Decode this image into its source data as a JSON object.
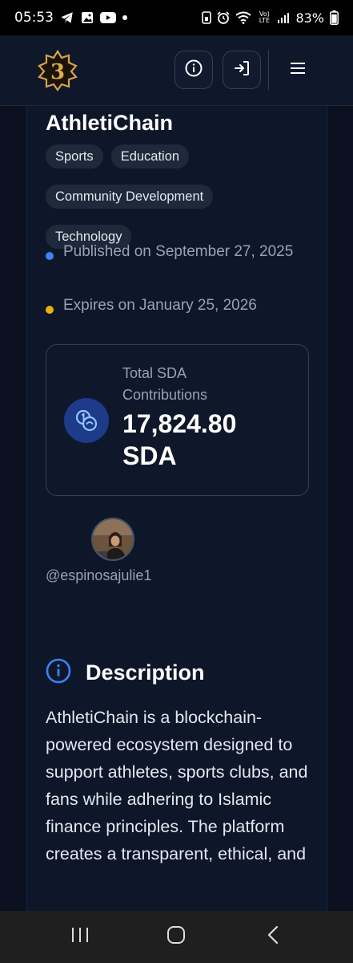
{
  "status_bar": {
    "time": "05:53",
    "battery": "83%",
    "left_icons": [
      "telegram-icon",
      "gallery-icon",
      "youtube-icon",
      "dot-icon"
    ],
    "right_icons": [
      "sim-icon",
      "alarm-icon",
      "wifi-icon",
      "volte-icon",
      "signal-icon",
      "battery-icon"
    ],
    "volte_label": "Vo) LTE"
  },
  "header": {
    "logo_icon": "brand-logo-icon",
    "info_icon": "info-icon",
    "login_icon": "login-icon",
    "menu_icon": "hamburger-menu-icon"
  },
  "campaign": {
    "title": "AthletiChain",
    "tags": [
      "Sports",
      "Education",
      "Community Development",
      "Technology"
    ],
    "published": "Published on September 27, 2025",
    "expires": "Expires on January 25, 2026",
    "published_dot_color": "#3b82f6",
    "expires_dot_color": "#eab308"
  },
  "stats": {
    "label": "Total SDA Contributions",
    "value": "17,824.80 SDA",
    "icon": "coins-icon"
  },
  "creator": {
    "username": "@espinosajulie1"
  },
  "description": {
    "heading": "Description",
    "icon": "info-icon",
    "text": "AthletiChain is a blockchain-powered ecosystem designed to support athletes, sports clubs, and fans while adhering to Islamic finance principles. The platform creates a transparent, ethical, and"
  },
  "nav": {
    "recents_icon": "recents-icon",
    "home_icon": "home-icon",
    "back_icon": "back-icon"
  },
  "colors": {
    "background": "#0b1120",
    "accent": "#3b82f6",
    "gold": "#d4a24c"
  }
}
